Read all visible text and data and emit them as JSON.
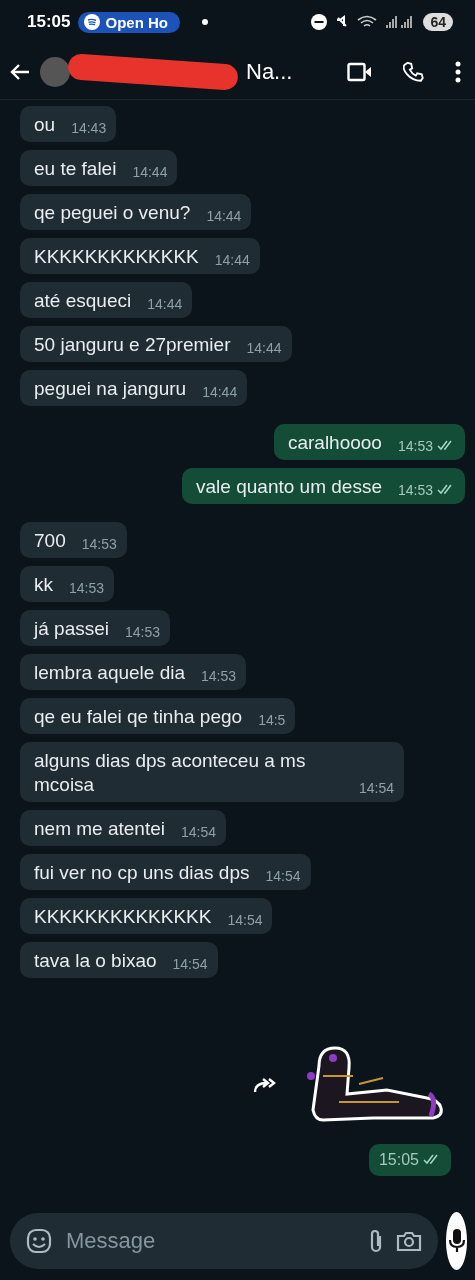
{
  "status_bar": {
    "time": "15:05",
    "media_pill": "Open Ho",
    "battery": "64"
  },
  "header": {
    "contact_name": "Na..."
  },
  "messages": [
    {
      "kind": "incoming",
      "text": "ou",
      "time": "14:43"
    },
    {
      "kind": "incoming",
      "text": "eu te falei",
      "time": "14:44"
    },
    {
      "kind": "incoming",
      "text": "qe peguei o venu?",
      "time": "14:44"
    },
    {
      "kind": "incoming",
      "text": "KKKKKKKKKKKKK",
      "time": "14:44"
    },
    {
      "kind": "incoming",
      "text": "até esqueci",
      "time": "14:44"
    },
    {
      "kind": "incoming",
      "text": "50 janguru e 27premier",
      "time": "14:44"
    },
    {
      "kind": "incoming",
      "text": "peguei na janguru",
      "time": "14:44"
    },
    {
      "kind": "outgoing",
      "text": "caralhoooo",
      "time": "14:53",
      "read": true
    },
    {
      "kind": "outgoing",
      "text": "vale quanto um desse",
      "time": "14:53",
      "read": true
    },
    {
      "kind": "incoming",
      "text": "700",
      "time": "14:53"
    },
    {
      "kind": "incoming",
      "text": "kk",
      "time": "14:53"
    },
    {
      "kind": "incoming",
      "text": "já passei",
      "time": "14:53"
    },
    {
      "kind": "incoming",
      "text": "lembra aquele dia",
      "time": "14:53"
    },
    {
      "kind": "incoming",
      "text": "qe eu falei qe tinha pego",
      "time": "14:5"
    },
    {
      "kind": "incoming",
      "text": "alguns dias dps aconteceu a ms mcoisa",
      "time": "14:54"
    },
    {
      "kind": "incoming",
      "text": "nem me atentei",
      "time": "14:54"
    },
    {
      "kind": "incoming",
      "text": "fui ver no cp uns dias dps",
      "time": "14:54"
    },
    {
      "kind": "incoming",
      "text": "KKKKKKKKKKKKKK",
      "time": "14:54"
    },
    {
      "kind": "incoming",
      "text": "tava la o bixao",
      "time": "14:54"
    }
  ],
  "sticker_message": {
    "time": "15:05",
    "read": true
  },
  "composer": {
    "placeholder": "Message"
  }
}
